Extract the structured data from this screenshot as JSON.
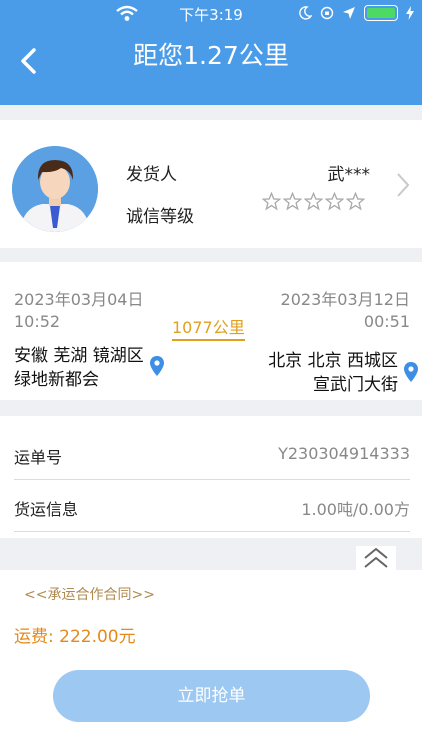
{
  "status_bar": {
    "time": "下午3:19",
    "icons": [
      "wifi-icon",
      "moon-icon",
      "orientation-lock-icon",
      "location-arrow-icon",
      "battery-icon",
      "charging-icon"
    ]
  },
  "header": {
    "title": "距您1.27公里",
    "back_icon": "chevron-left-icon"
  },
  "shipper": {
    "label": "发货人",
    "name": "武***",
    "credit_label": "诚信等级",
    "credit_stars_filled": 0,
    "credit_stars_total": 5,
    "chevron_icon": "chevron-right-icon"
  },
  "route": {
    "start_datetime": "2023年03月04日 10:52",
    "end_datetime": "2023年03月12日 00:51",
    "distance": "1077公里",
    "origin": "安徽 芜湖 镜湖区绿地新都会",
    "destination": "北京 北京 西城区宣武门大街",
    "pin_icon": "location-pin-icon"
  },
  "info": {
    "waybill_label": "运单号",
    "waybill_value": "Y230304914333",
    "cargo_label": "货运信息",
    "cargo_value": "1.00吨/0.00方"
  },
  "footer": {
    "contract_link": "<<承运合作合同>>",
    "fee": "运费: 222.00元",
    "grab_button": "立即抢单",
    "collapse_icon": "double-chevron-up-icon"
  },
  "colors": {
    "header_blue": "#4a9be8",
    "distance_orange": "#e0a020",
    "fee_orange": "#e5891a",
    "button_blue": "#9cc8f2",
    "pin_blue": "#3d8fe6"
  }
}
